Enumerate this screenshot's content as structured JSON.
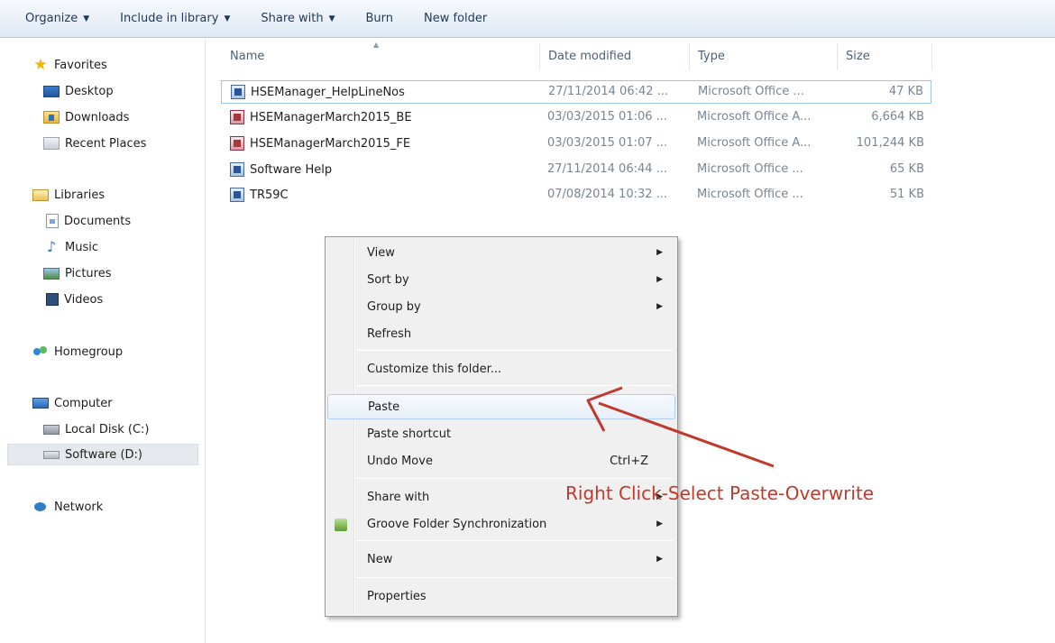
{
  "toolbar": {
    "organize": "Organize",
    "include_in_library": "Include in library",
    "share_with": "Share with",
    "burn": "Burn",
    "new_folder": "New folder"
  },
  "nav": {
    "favorites": "Favorites",
    "desktop": "Desktop",
    "downloads": "Downloads",
    "recent_places": "Recent Places",
    "libraries": "Libraries",
    "documents": "Documents",
    "music": "Music",
    "pictures": "Pictures",
    "videos": "Videos",
    "homegroup": "Homegroup",
    "computer": "Computer",
    "local_disk": "Local Disk (C:)",
    "software_drive": "Software (D:)",
    "network": "Network"
  },
  "columns": {
    "name": "Name",
    "date_modified": "Date modified",
    "type": "Type",
    "size": "Size"
  },
  "files": [
    {
      "name": "HSEManager_HelpLineNos",
      "date": "27/11/2014 06:42 ...",
      "type": "Microsoft Office ...",
      "size": "47 KB",
      "icon": "word-doc-icon"
    },
    {
      "name": "HSEManagerMarch2015_BE",
      "date": "03/03/2015 01:06 ...",
      "type": "Microsoft Office A...",
      "size": "6,664 KB",
      "icon": "access-db-icon"
    },
    {
      "name": "HSEManagerMarch2015_FE",
      "date": "03/03/2015 01:07 ...",
      "type": "Microsoft Office A...",
      "size": "101,244 KB",
      "icon": "access-db-icon"
    },
    {
      "name": "Software Help",
      "date": "27/11/2014 06:44 ...",
      "type": "Microsoft Office ...",
      "size": "65 KB",
      "icon": "word-doc-icon"
    },
    {
      "name": "TR59C",
      "date": "07/08/2014 10:32 ...",
      "type": "Microsoft Office ...",
      "size": "51 KB",
      "icon": "word-doc-icon"
    }
  ],
  "context_menu": {
    "view": "View",
    "sort_by": "Sort by",
    "group_by": "Group by",
    "refresh": "Refresh",
    "customize": "Customize this folder...",
    "paste": "Paste",
    "paste_shortcut": "Paste shortcut",
    "undo_move": "Undo Move",
    "undo_shortcut": "Ctrl+Z",
    "share_with": "Share with",
    "groove": "Groove Folder Synchronization",
    "new": "New",
    "properties": "Properties"
  },
  "annotation": {
    "text": "Right Click-Select Paste-Overwrite",
    "color": "#c0392b"
  }
}
